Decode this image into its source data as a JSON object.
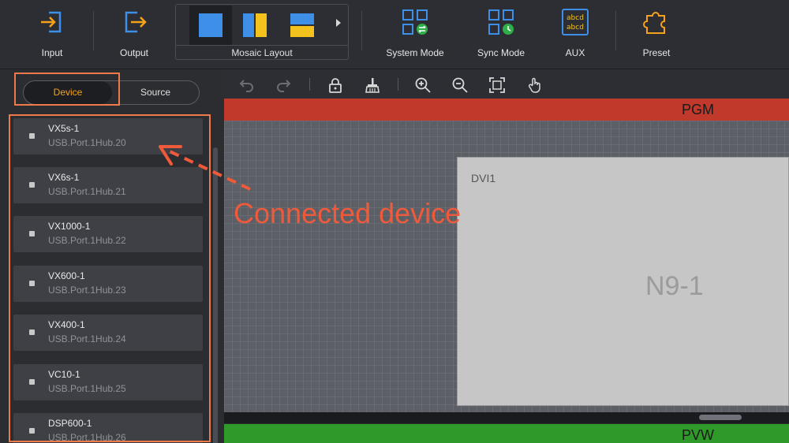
{
  "toolbar": {
    "input_label": "Input",
    "output_label": "Output",
    "mosaic_label": "Mosaic Layout",
    "system_mode_label": "System Mode",
    "sync_mode_label": "Sync Mode",
    "aux_label": "AUX",
    "preset_label": "Preset",
    "aux_icon_text": "abcd"
  },
  "panel": {
    "tabs": {
      "device": "Device",
      "source": "Source"
    },
    "devices": [
      {
        "name": "VX5s-1",
        "port": "USB.Port.1Hub.20"
      },
      {
        "name": "VX6s-1",
        "port": "USB.Port.1Hub.21"
      },
      {
        "name": "VX1000-1",
        "port": "USB.Port.1Hub.22"
      },
      {
        "name": "VX600-1",
        "port": "USB.Port.1Hub.23"
      },
      {
        "name": "VX400-1",
        "port": "USB.Port.1Hub.24"
      },
      {
        "name": "VC10-1",
        "port": "USB.Port.1Hub.25"
      },
      {
        "name": "DSP600-1",
        "port": "USB.Port.1Hub.26"
      }
    ]
  },
  "canvas": {
    "pgm_label": "PGM",
    "pvw_label": "PVW",
    "screen": {
      "input": "DVI1",
      "name": "N9-1"
    }
  },
  "annotation": {
    "text": "Connected device",
    "color": "#ee5a3a"
  },
  "colors": {
    "accent": "#f4a21c",
    "icon_blue": "#3d8fe8",
    "pgm": "#c0392b",
    "pvw": "#2f9a2a"
  }
}
